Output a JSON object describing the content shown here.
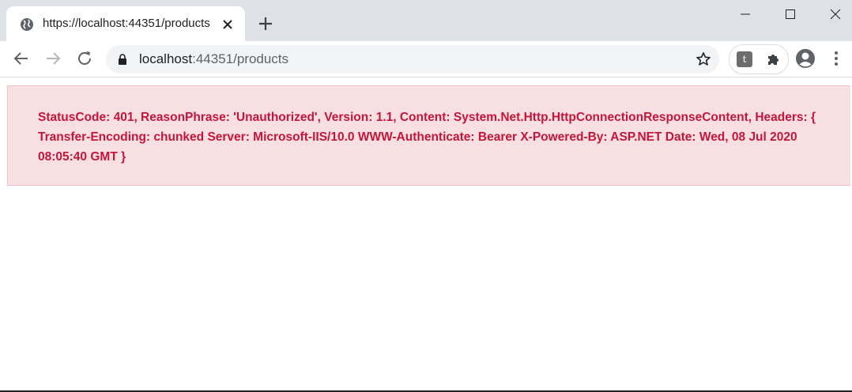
{
  "tab": {
    "title": "https://localhost:44351/products"
  },
  "address_bar": {
    "host": "localhost",
    "port_path": ":44351/products"
  },
  "extension": {
    "letter": "t"
  },
  "alert": {
    "message": "StatusCode: 401, ReasonPhrase: 'Unauthorized', Version: 1.1, Content: System.Net.Http.HttpConnectionResponseContent, Headers: { Transfer-Encoding: chunked Server: Microsoft-IIS/10.0 WWW-Authenticate: Bearer X-Powered-By: ASP.NET Date: Wed, 08 Jul 2020 08:05:40 GMT }"
  },
  "colors": {
    "alert_background": "#f8dfe2",
    "alert_text": "#c4163a",
    "titlebar": "#dee1e6"
  },
  "icons": [
    "globe-icon",
    "close-icon",
    "plus-icon",
    "minimize-icon",
    "maximize-icon",
    "window-close-icon",
    "back-icon",
    "forward-icon",
    "reload-icon",
    "lock-icon",
    "star-icon",
    "puzzle-icon",
    "profile-icon",
    "menu-icon"
  ]
}
